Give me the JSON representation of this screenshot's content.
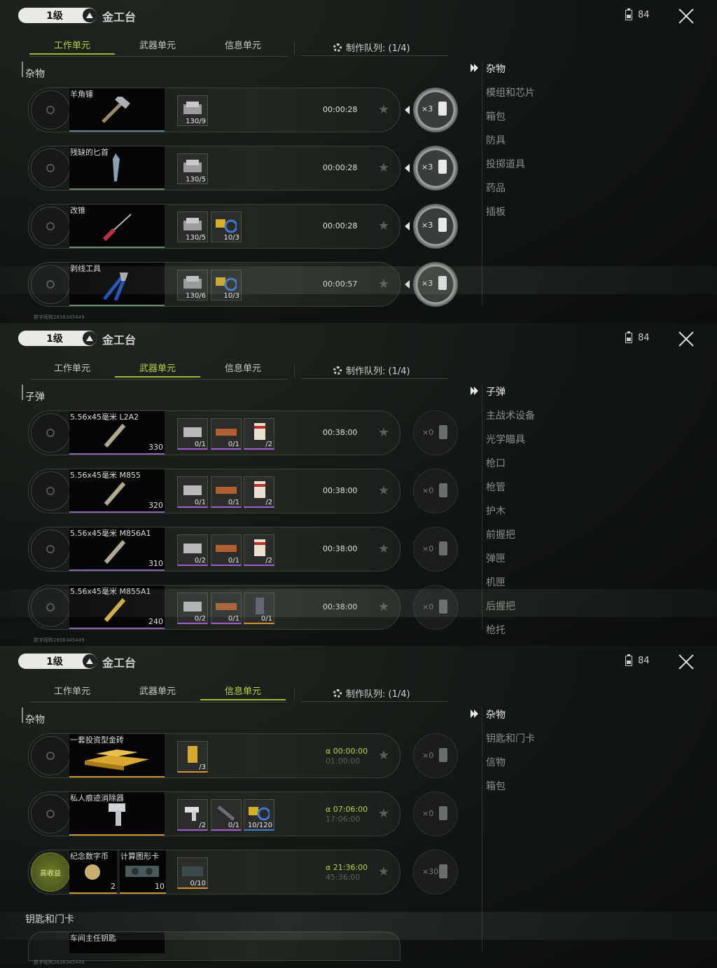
{
  "header": {
    "level_label": "1级",
    "bench_title": "金工台",
    "battery_count": "84"
  },
  "tabs": [
    "工作单元",
    "武器单元",
    "信息单元"
  ],
  "queue_label": "制作队列: (1/4)",
  "watermark": "数字昵称2838345449",
  "panel1": {
    "section": "杂物",
    "categories": [
      "杂物",
      "模组和芯片",
      "箱包",
      "防具",
      "投掷道具",
      "药品",
      "插板"
    ],
    "rows": [
      {
        "name": "羊角锤",
        "mats": [
          "130/9"
        ],
        "time": "00:00:28",
        "craft": "×3"
      },
      {
        "name": "残缺的匕首",
        "mats": [
          "130/5"
        ],
        "time": "00:00:28",
        "craft": "×3"
      },
      {
        "name": "改锥",
        "mats": [
          "130/5",
          "10/3"
        ],
        "time": "00:00:28",
        "craft": "×3"
      },
      {
        "name": "剥线工具",
        "mats": [
          "130/6",
          "10/3"
        ],
        "time": "00:00:57",
        "craft": "×3"
      }
    ]
  },
  "panel2": {
    "section": "子弹",
    "categories": [
      "子弹",
      "主战术设备",
      "光学瞄具",
      "枪口",
      "枪管",
      "护木",
      "前握把",
      "弹匣",
      "机匣",
      "后握把",
      "枪托"
    ],
    "rows": [
      {
        "name": "5.56x45毫米 L2A2",
        "qty": "330",
        "mats": [
          "0/1",
          "0/1",
          "/2"
        ],
        "time": "00:38:00",
        "craft": "×0"
      },
      {
        "name": "5.56x45毫米 M855",
        "qty": "320",
        "mats": [
          "0/1",
          "0/1",
          "/2"
        ],
        "time": "00:38:00",
        "craft": "×0"
      },
      {
        "name": "5.56x45毫米 M856A1",
        "qty": "310",
        "mats": [
          "0/2",
          "0/1",
          "/2"
        ],
        "time": "00:38:00",
        "craft": "×0"
      },
      {
        "name": "5.56x45毫米 M855A1",
        "qty": "240",
        "mats": [
          "0/2",
          "0/1",
          "0/1"
        ],
        "time": "00:38:00",
        "craft": "×0"
      }
    ]
  },
  "panel3": {
    "section": "杂物",
    "section2": "钥匙和门卡",
    "categories": [
      "杂物",
      "钥匙和门卡",
      "信物",
      "箱包"
    ],
    "rows": [
      {
        "name": "一套投资型金砖",
        "mats": [
          "/3"
        ],
        "time": "α 00:00:00",
        "time_sub": "01:00:00",
        "craft": "×0"
      },
      {
        "name": "私人痕迹消除器",
        "mats": [
          "/2",
          "0/1",
          "10/120"
        ],
        "time": "α 07:06:00",
        "time_sub": "17:06:00",
        "craft": "×0"
      },
      {
        "name": "纪念数字币",
        "qty": "2",
        "name2": "计算图形卡",
        "qty2": "10",
        "badge": "高收益",
        "mats": [
          "0/10"
        ],
        "time": "α 21:36:00",
        "time_sub": "45:36:00",
        "craft": "×30"
      }
    ],
    "partial_row": "车间主任钥匙"
  }
}
